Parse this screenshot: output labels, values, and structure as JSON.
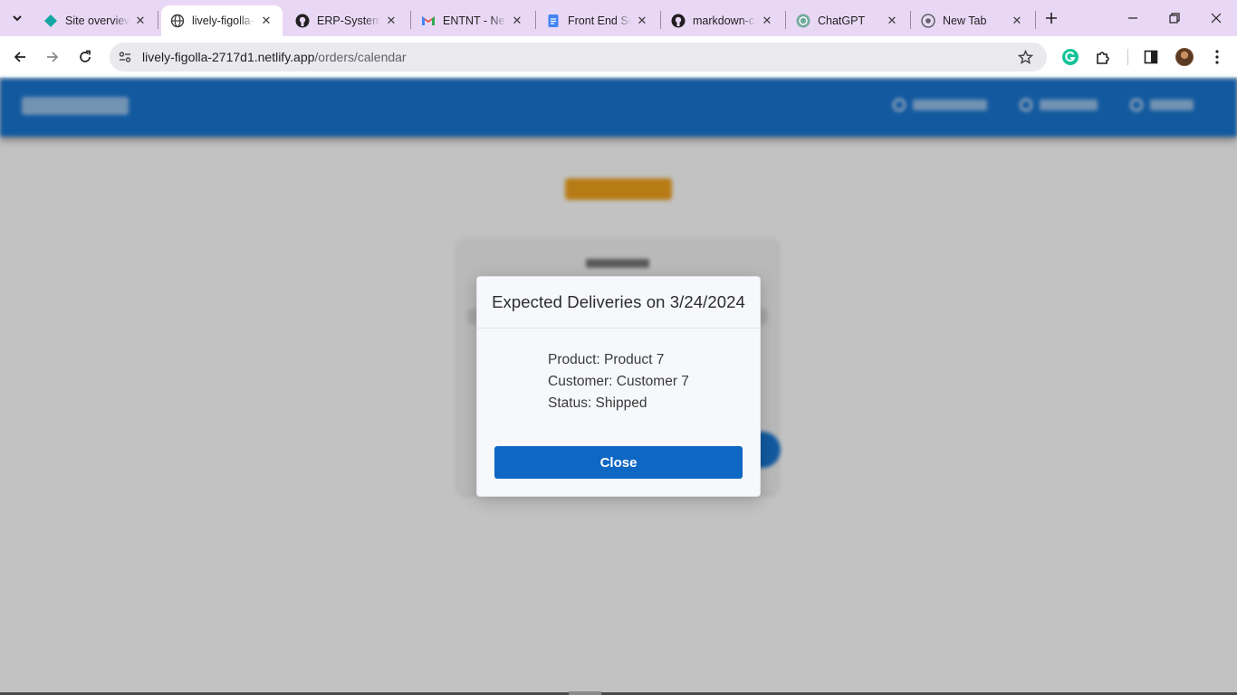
{
  "browser": {
    "tabs": [
      {
        "title": "Site overview",
        "icon": "netlify-icon"
      },
      {
        "title": "lively-figolla-",
        "icon": "globe-icon",
        "active": true
      },
      {
        "title": "ERP-System/",
        "icon": "github-icon"
      },
      {
        "title": "ENTNT - Ne",
        "icon": "gmail-icon"
      },
      {
        "title": "Front End Sc",
        "icon": "docs-icon"
      },
      {
        "title": "markdown-c",
        "icon": "github-icon"
      },
      {
        "title": "ChatGPT",
        "icon": "chatgpt-icon"
      },
      {
        "title": "New Tab",
        "icon": "chrome-icon"
      }
    ],
    "address": {
      "host": "lively-figolla-2717d1.netlify.app",
      "path": "/orders/calendar"
    }
  },
  "modal": {
    "title": "Expected Deliveries on 3/24/2024",
    "product": "Product: Product 7",
    "customer": "Customer: Customer 7",
    "status": "Status: Shipped",
    "close_label": "Close"
  },
  "colors": {
    "navbar": "#1976d2",
    "close_button": "#0f67c4",
    "heading": "#f1a21c",
    "tabstrip": "#e9d8f5"
  }
}
